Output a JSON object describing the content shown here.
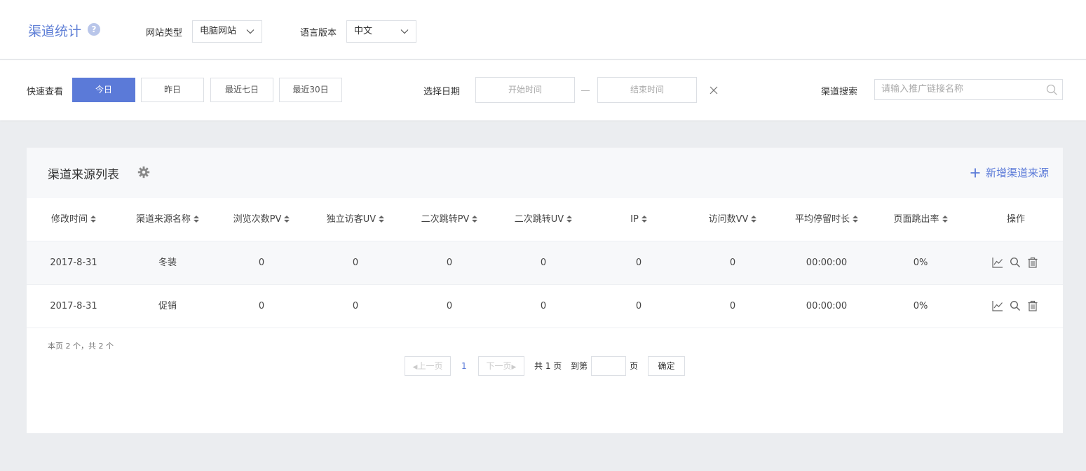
{
  "header": {
    "title": "渠道统计",
    "help_glyph": "?",
    "site_type_label": "网站类型",
    "site_type_value": "电脑网站",
    "lang_label": "语言版本",
    "lang_value": "中文"
  },
  "filters": {
    "quick_label": "快速查看",
    "quick_buttons": [
      "今日",
      "昨日",
      "最近七日",
      "最近30日"
    ],
    "date_label": "选择日期",
    "start_placeholder": "开始时间",
    "end_placeholder": "结束时间",
    "search_label": "渠道搜索",
    "search_placeholder": "请输入推广链接名称"
  },
  "panel": {
    "title": "渠道来源列表",
    "add_label": "新增渠道来源"
  },
  "table": {
    "columns": [
      "修改时间",
      "渠道来源名称",
      "浏览次数PV",
      "独立访客UV",
      "二次跳转PV",
      "二次跳转UV",
      "IP",
      "访问数VV",
      "平均停留时长",
      "页面跳出率",
      "操作"
    ],
    "rows": [
      [
        "2017-8-31",
        "冬装",
        "0",
        "0",
        "0",
        "0",
        "0",
        "0",
        "00:00:00",
        "0%"
      ],
      [
        "2017-8-31",
        "促销",
        "0",
        "0",
        "0",
        "0",
        "0",
        "0",
        "00:00:00",
        "0%"
      ]
    ]
  },
  "pagination": {
    "summary": "本页 2 个，共 2 个",
    "prev": "上一页",
    "current": "1",
    "next": "下一页",
    "total": "共 1 页",
    "goto": "到第",
    "page_unit": "页",
    "confirm": "确定"
  },
  "colors": {
    "accent": "#5b7ad8",
    "title": "#5f7fd6",
    "background": "#ebedf0"
  }
}
